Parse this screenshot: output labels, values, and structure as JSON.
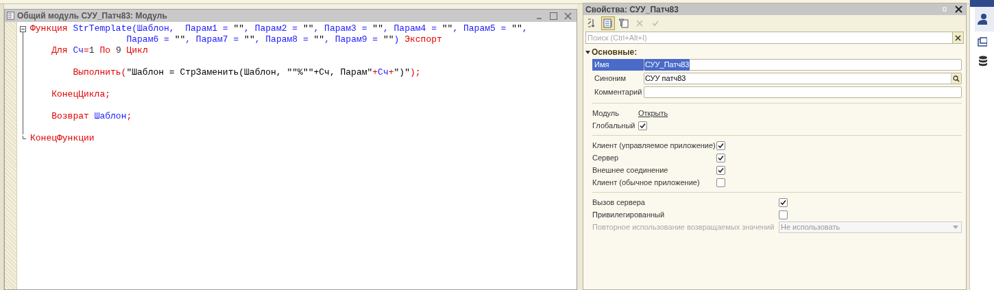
{
  "editor": {
    "title": "Общий модуль СУУ_Патч83: Модуль",
    "lines": [
      {
        "kind": "fold_start",
        "tokens": [
          {
            "kind": "keyword",
            "t": "Функция "
          },
          {
            "kind": "ident",
            "t": "StrTemplate(Шаблон,  Парам1 = "
          },
          {
            "kind": "string",
            "t": "\"\""
          },
          {
            "kind": "ident",
            "t": ", Парам2 = "
          },
          {
            "kind": "string",
            "t": "\"\""
          },
          {
            "kind": "ident",
            "t": ", Парам3 = "
          },
          {
            "kind": "string",
            "t": "\"\""
          },
          {
            "kind": "ident",
            "t": ", Парам4 = "
          },
          {
            "kind": "string",
            "t": "\"\""
          },
          {
            "kind": "ident",
            "t": ", Парам5 = "
          },
          {
            "kind": "string",
            "t": "\"\""
          },
          {
            "kind": "ident",
            "t": ","
          }
        ]
      },
      {
        "kind": "code",
        "tokens": [
          {
            "kind": "ident",
            "t": "                  Парам6 = "
          },
          {
            "kind": "string",
            "t": "\"\""
          },
          {
            "kind": "ident",
            "t": ", Парам7 = "
          },
          {
            "kind": "string",
            "t": "\"\""
          },
          {
            "kind": "ident",
            "t": ", Парам8 = "
          },
          {
            "kind": "string",
            "t": "\"\""
          },
          {
            "kind": "ident",
            "t": ", Парам9 = "
          },
          {
            "kind": "string",
            "t": "\"\""
          },
          {
            "kind": "ident",
            "t": ")"
          },
          {
            "kind": "keyword",
            "t": " Экспорт"
          }
        ]
      },
      {
        "kind": "code",
        "tokens": [
          {
            "kind": "keyword",
            "t": "    Для "
          },
          {
            "kind": "ident",
            "t": "Сч"
          },
          {
            "kind": "keyword",
            "t": "="
          },
          {
            "kind": "number",
            "t": "1"
          },
          {
            "kind": "keyword",
            "t": " По "
          },
          {
            "kind": "number",
            "t": "9"
          },
          {
            "kind": "keyword",
            "t": " Цикл"
          }
        ]
      },
      {
        "kind": "blank"
      },
      {
        "kind": "code",
        "tokens": [
          {
            "kind": "keyword",
            "t": "        Выполнить("
          },
          {
            "kind": "string",
            "t": "\"Шаблон = СтрЗаменить(Шаблон, \"\"%\"\"+Сч, Парам\""
          },
          {
            "kind": "keyword",
            "t": "+"
          },
          {
            "kind": "ident",
            "t": "Сч"
          },
          {
            "kind": "keyword",
            "t": "+"
          },
          {
            "kind": "string",
            "t": "\")\""
          },
          {
            "kind": "keyword",
            "t": ");"
          }
        ]
      },
      {
        "kind": "blank"
      },
      {
        "kind": "code",
        "tokens": [
          {
            "kind": "keyword",
            "t": "    КонецЦикла;"
          }
        ]
      },
      {
        "kind": "blank"
      },
      {
        "kind": "code",
        "tokens": [
          {
            "kind": "keyword",
            "t": "    Возврат "
          },
          {
            "kind": "ident",
            "t": "Шаблон"
          },
          {
            "kind": "keyword",
            "t": ";"
          }
        ]
      },
      {
        "kind": "blank"
      },
      {
        "kind": "fold_end",
        "tokens": [
          {
            "kind": "keyword",
            "t": "КонецФункции"
          }
        ]
      }
    ]
  },
  "properties": {
    "title": "Свойства: СУУ_Патч83",
    "toolbar": [
      {
        "kind": "sort",
        "selected": false
      },
      {
        "kind": "categories",
        "selected": true
      },
      {
        "kind": "filter",
        "selected": false
      },
      {
        "kind": "cancel",
        "disabled": true
      },
      {
        "kind": "apply",
        "disabled": true
      }
    ],
    "search": {
      "placeholder": "Поиск (Ctrl+Alt+I)"
    },
    "section": {
      "label": "Основные:",
      "expanded": true
    },
    "fields": [
      {
        "kind": "text",
        "label": "Имя",
        "value": "СУУ_Патч83",
        "selected": true
      },
      {
        "kind": "search",
        "label": "Синоним",
        "value": "СУУ патч83",
        "selected": false
      },
      {
        "kind": "text",
        "label": "Комментарий",
        "selected": false
      }
    ],
    "groups": [
      [
        {
          "kind": "link",
          "label": "Модуль",
          "link": "Открыть"
        },
        {
          "kind": "check",
          "label": "Глобальный",
          "checked": true
        }
      ],
      [
        {
          "kind": "check",
          "label": "Клиент (управляемое приложение)",
          "checked": true
        },
        {
          "kind": "check",
          "label": "Сервер",
          "checked": true
        },
        {
          "kind": "check",
          "label": "Внешнее соединение",
          "checked": true
        },
        {
          "kind": "check",
          "label": "Клиент (обычное приложение)",
          "checked": false
        }
      ],
      [
        {
          "kind": "check",
          "label": "Вызов сервера",
          "checked": true
        },
        {
          "kind": "check",
          "label": "Привилегированный",
          "checked": false
        },
        {
          "kind": "select",
          "label": "Повторное использование возвращаемых значений",
          "value": "Не использовать",
          "disabled": true
        }
      ]
    ]
  }
}
